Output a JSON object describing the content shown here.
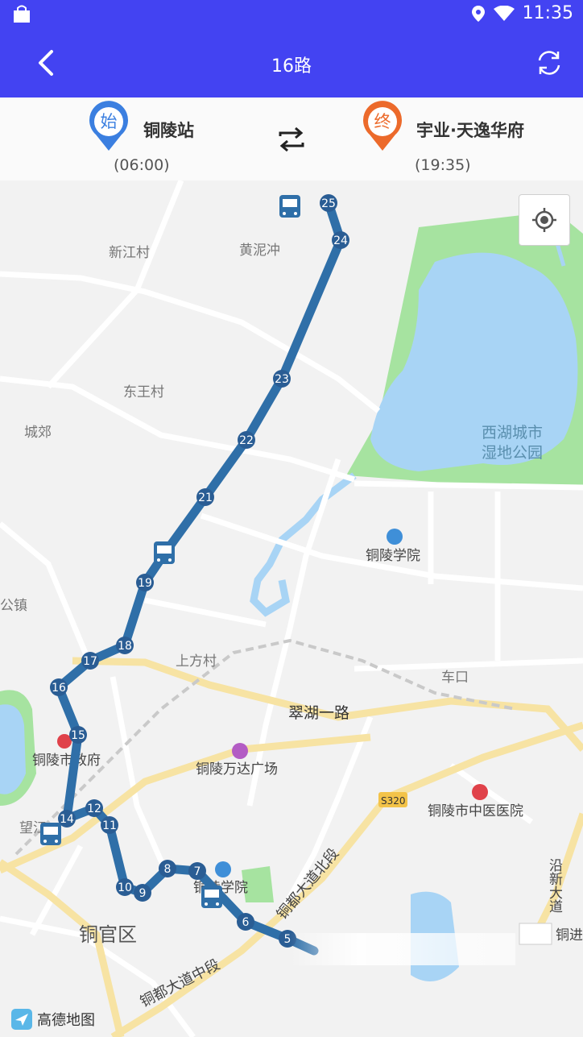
{
  "status": {
    "time": "11:35"
  },
  "header": {
    "title": "16路"
  },
  "start": {
    "badge": "始",
    "name": "铜陵站",
    "time": "(06:00)"
  },
  "end": {
    "badge": "终",
    "name": "宇业·天逸华府",
    "time": "(19:35)"
  },
  "map": {
    "labels": {
      "xinjiang": "新江村",
      "huangnichong": "黄泥冲",
      "dongwang": "东王村",
      "chengjiao": "城郊",
      "xihu": "西湖城市",
      "xihu2": "湿地公园",
      "xueyuan": "铜陵学院",
      "gongzhen": "公镇",
      "shangfang": "上方村",
      "chekou": "车口",
      "cuihu": "翠湖一路",
      "zhengfu": "铜陵市政府",
      "wanda": "铜陵万达广场",
      "s320": "S320",
      "zhongyi": "铜陵市中医医院",
      "wangjiang": "望江",
      "tongguan": "铜官区",
      "beiduan": "铜都大道北段",
      "zhongduan": "铜都大道中段",
      "tongxue": "铜陵学院",
      "yanxin": "沿新大道",
      "tongjin": "铜进"
    },
    "stops": [
      "25",
      "24",
      "23",
      "22",
      "21",
      "19",
      "18",
      "17",
      "16",
      "15",
      "14",
      "12",
      "11",
      "10",
      "9",
      "8",
      "7",
      "6",
      "5"
    ]
  },
  "footer": {
    "brand": "高德地图"
  },
  "colors": {
    "primary": "#4343f2",
    "route": "#2f6fa8",
    "start_pin": "#3b7fe0",
    "end_pin": "#ec6a2b",
    "water": "#a8d4f5",
    "park": "#a6e3a0"
  }
}
